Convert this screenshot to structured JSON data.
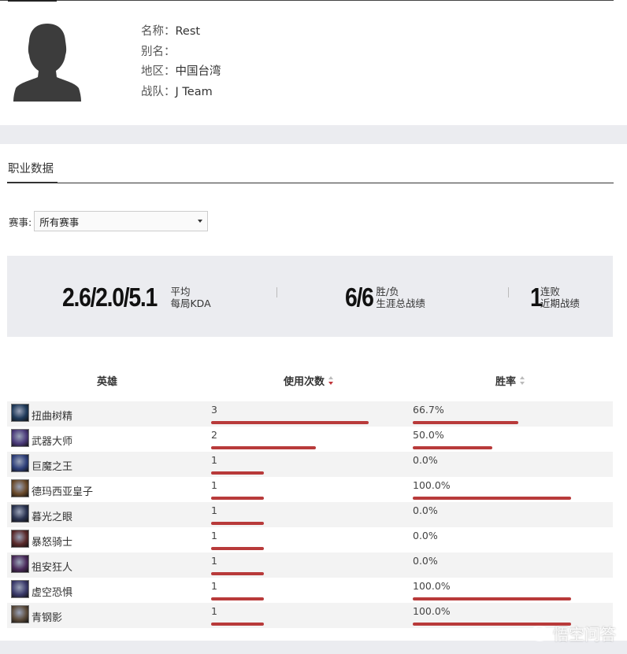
{
  "profile": {
    "name_label": "名称：",
    "name": "Rest",
    "alias_label": "别名：",
    "alias": "",
    "region_label": "地区：",
    "region": "中国台湾",
    "team_label": "战队：",
    "team": "J Team"
  },
  "section": {
    "title": "职业数据"
  },
  "filter": {
    "label": "赛事:",
    "selected": "所有赛事"
  },
  "stats": {
    "kda": {
      "value": "2.6/2.0/5.1",
      "line1": "平均",
      "line2": "每局KDA"
    },
    "career": {
      "value": "6/6",
      "line1": "胜/负",
      "line2": "生涯总战绩"
    },
    "recent": {
      "value": "1",
      "line1": "连败",
      "line2": "近期战绩"
    }
  },
  "table": {
    "headers": {
      "hero": "英雄",
      "games": "使用次数",
      "winrate": "胜率"
    },
    "max_games": 3,
    "rows": [
      {
        "hero": "扭曲树精",
        "games": "3",
        "games_value": 3,
        "winrate": "66.7%",
        "winrate_value": 66.7,
        "icon_color": "#1f3a5a"
      },
      {
        "hero": "武器大师",
        "games": "2",
        "games_value": 2,
        "winrate": "50.0%",
        "winrate_value": 50.0,
        "icon_color": "#4b3a7a"
      },
      {
        "hero": "巨魔之王",
        "games": "1",
        "games_value": 1,
        "winrate": "0.0%",
        "winrate_value": 0,
        "icon_color": "#2e3f7a"
      },
      {
        "hero": "德玛西亚皇子",
        "games": "1",
        "games_value": 1,
        "winrate": "100.0%",
        "winrate_value": 100,
        "icon_color": "#6a4a2a"
      },
      {
        "hero": "暮光之眼",
        "games": "1",
        "games_value": 1,
        "winrate": "0.0%",
        "winrate_value": 0,
        "icon_color": "#2a3350"
      },
      {
        "hero": "暴怒骑士",
        "games": "1",
        "games_value": 1,
        "winrate": "0.0%",
        "winrate_value": 0,
        "icon_color": "#5a2a2a"
      },
      {
        "hero": "祖安狂人",
        "games": "1",
        "games_value": 1,
        "winrate": "0.0%",
        "winrate_value": 0,
        "icon_color": "#4a2a5a"
      },
      {
        "hero": "虚空恐惧",
        "games": "1",
        "games_value": 1,
        "winrate": "100.0%",
        "winrate_value": 100,
        "icon_color": "#3a3a6a"
      },
      {
        "hero": "青钢影",
        "games": "1",
        "games_value": 1,
        "winrate": "100.0%",
        "winrate_value": 100,
        "icon_color": "#5a4a3a"
      }
    ]
  },
  "watermark": "悟空问答",
  "colors": {
    "accent_bar": "#b83a3a",
    "band": "#ebecf0",
    "alt_row": "#f3f3f3"
  }
}
